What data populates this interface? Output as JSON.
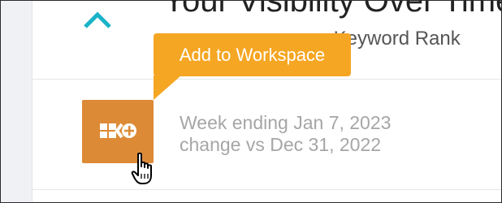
{
  "header": {
    "title": "Your Visibility Over Time",
    "subtitle": "r Keyword Rank"
  },
  "tooltip": {
    "text": "Add to Workspace",
    "color": "#f5a623"
  },
  "workspace_button": {
    "icon": "add-to-workspace-icon",
    "color": "#dd8a36"
  },
  "collapse_button": {
    "icon": "chevron-up-icon",
    "color": "#1ab3c8"
  },
  "week_info": {
    "line1": "Week ending Jan 7, 2023",
    "line2": "change vs Dec 31, 2022"
  },
  "cursor": {
    "icon": "hand-pointer-cursor-icon"
  }
}
